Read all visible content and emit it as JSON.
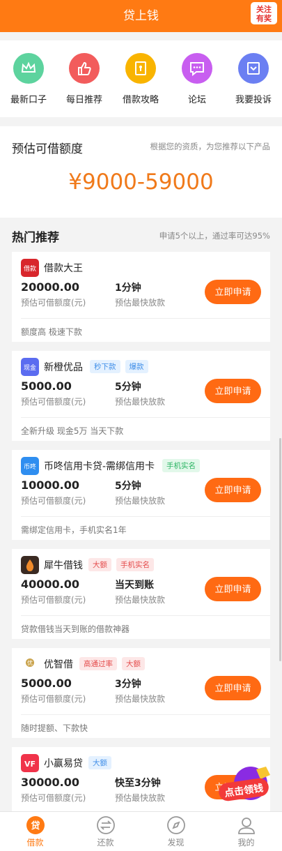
{
  "header": {
    "title": "贷上钱",
    "follow_badge": "关注有奖"
  },
  "quick_menu": [
    {
      "label": "最新口子",
      "icon": "crown-icon",
      "color": "#5dd39e"
    },
    {
      "label": "每日推荐",
      "icon": "thumbs-up-icon",
      "color": "#f25c5c"
    },
    {
      "label": "借款攻略",
      "icon": "book-icon",
      "color": "#f9b400"
    },
    {
      "label": "论坛",
      "icon": "chat-icon",
      "color": "#c85ef0"
    },
    {
      "label": "我要投诉",
      "icon": "inbox-icon",
      "color": "#6b7ff2"
    }
  ],
  "estimate": {
    "title": "预估可借额度",
    "note": "根据您的资质，为您推荐以下产品",
    "amount": "¥9000-59000"
  },
  "hot": {
    "title": "热门推荐",
    "note": "申请5个以上，通过率可达95%"
  },
  "products": [
    {
      "name": "借款大王",
      "tags": [],
      "amount": "20000.00",
      "amount_label": "预估可借额度(元)",
      "speed": "1分钟",
      "speed_label": "预估最快放款",
      "apply_label": "立即申请",
      "desc": "额度高 极速下款",
      "logo_color": "#d8262c",
      "logo_text": "借款"
    },
    {
      "name": "新橙优品",
      "tags": [
        {
          "text": "秒下款",
          "color": "blue"
        },
        {
          "text": "爆款",
          "color": "blue"
        }
      ],
      "amount": "5000.00",
      "amount_label": "预估可借额度(元)",
      "speed": "5分钟",
      "speed_label": "预估最快放款",
      "apply_label": "立即申请",
      "desc": "全新升级 现金5万 当天下款",
      "logo_color": "#5b6cf0",
      "logo_text": "现金"
    },
    {
      "name": "币咚信用卡贷-需绑信用卡",
      "tags": [
        {
          "text": "手机实名",
          "color": "green"
        }
      ],
      "amount": "10000.00",
      "amount_label": "预估可借额度(元)",
      "speed": "5分钟",
      "speed_label": "预估最快放款",
      "apply_label": "立即申请",
      "desc": "需绑定信用卡，手机实名1年",
      "logo_color": "#2f8ef0",
      "logo_text": "币咚"
    },
    {
      "name": "犀牛借钱",
      "tags": [
        {
          "text": "大额",
          "color": "red"
        },
        {
          "text": "手机实名",
          "color": "red"
        }
      ],
      "amount": "40000.00",
      "amount_label": "预估可借额度(元)",
      "speed": "当天到账",
      "speed_label": "预估最快放款",
      "apply_label": "立即申请",
      "desc": "贷款借钱当天到账的借款神器",
      "logo_color": "#3a2a22",
      "logo_text": ""
    },
    {
      "name": "优智借",
      "tags": [
        {
          "text": "高通过率",
          "color": "red"
        },
        {
          "text": "大额",
          "color": "red"
        }
      ],
      "amount": "5000.00",
      "amount_label": "预估可借额度(元)",
      "speed": "3分钟",
      "speed_label": "预估最快放款",
      "apply_label": "立即申请",
      "desc": "随时提额、下款快",
      "logo_color": "#c9a24a",
      "logo_text": "优"
    },
    {
      "name": "小赢易贷",
      "tags": [
        {
          "text": "大额",
          "color": "blue"
        }
      ],
      "amount": "30000.00",
      "amount_label": "预估可借额度(元)",
      "speed": "快至3分钟",
      "speed_label": "预估最快放款",
      "apply_label": "立即申请",
      "desc": "",
      "logo_color": "#f0334a",
      "logo_text": "VF"
    }
  ],
  "float_badge": "点击领钱",
  "tabbar": [
    {
      "label": "借款",
      "icon": "loan-icon",
      "active": true
    },
    {
      "label": "还款",
      "icon": "repay-icon",
      "active": false
    },
    {
      "label": "发现",
      "icon": "compass-icon",
      "active": false
    },
    {
      "label": "我的",
      "icon": "user-icon",
      "active": false
    }
  ]
}
